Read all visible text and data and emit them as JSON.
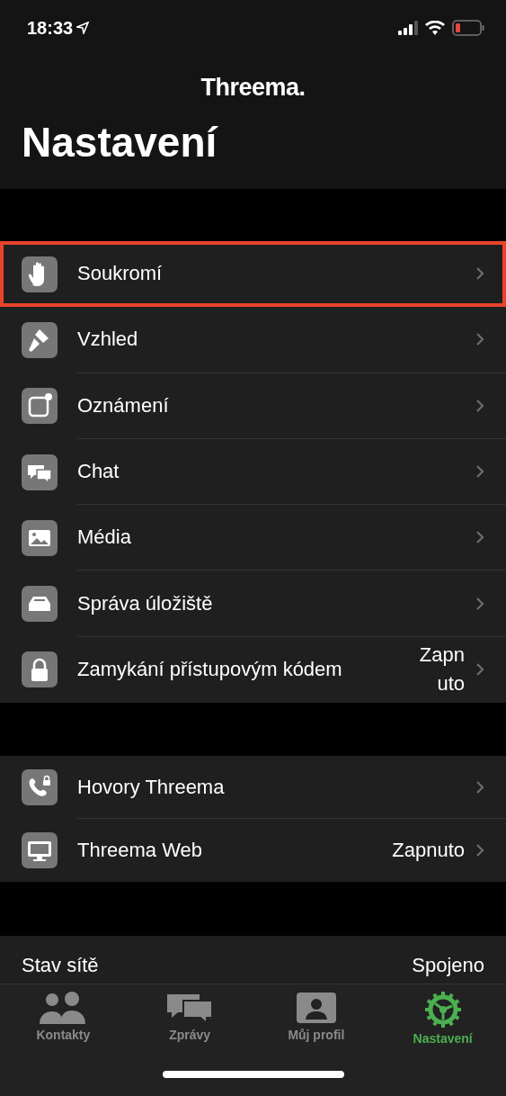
{
  "status_bar": {
    "time": "18:33"
  },
  "header": {
    "logo": "Threema.",
    "title": "Nastavení"
  },
  "sections": [
    {
      "rows": [
        {
          "kind": "hand",
          "label": "Soukromí",
          "highlighted": true
        },
        {
          "kind": "brush",
          "label": "Vzhled",
          "highlighted": false
        },
        {
          "kind": "notification",
          "label": "Oznámení",
          "highlighted": false
        },
        {
          "kind": "chat",
          "label": "Chat",
          "highlighted": false
        },
        {
          "kind": "image",
          "label": "Média",
          "highlighted": false
        },
        {
          "kind": "tray",
          "label": "Správa úložiště",
          "highlighted": false
        },
        {
          "kind": "lock",
          "label": "Zamykání přístupovým kódem",
          "value": "Zapnuto",
          "highlighted": false
        }
      ]
    },
    {
      "rows": [
        {
          "kind": "phone",
          "label": "Hovory Threema",
          "highlighted": false
        },
        {
          "kind": "monitor",
          "label": "Threema Web",
          "value": "Zapnuto",
          "highlighted": false
        }
      ]
    }
  ],
  "network": {
    "label": "Stav sítě",
    "value": "Spojeno"
  },
  "tabs": [
    {
      "kind": "people",
      "label": "Kontakty",
      "selected": false
    },
    {
      "kind": "bubbles",
      "label": "Zprávy",
      "selected": false
    },
    {
      "kind": "profile",
      "label": "Můj profil",
      "selected": false
    },
    {
      "kind": "gear",
      "label": "Nastavení",
      "selected": true
    }
  ]
}
